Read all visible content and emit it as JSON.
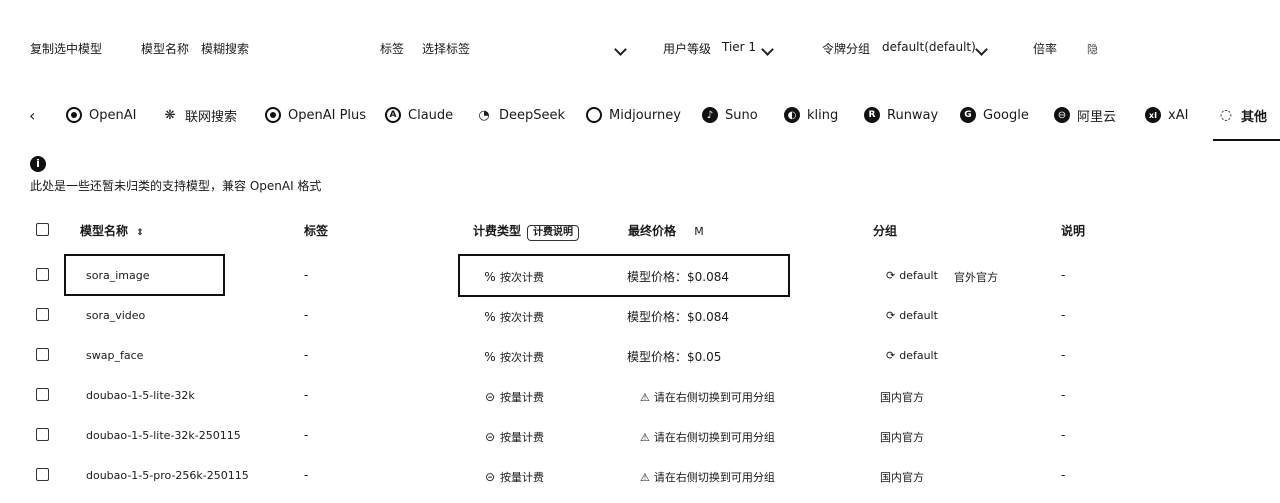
{
  "filters": {
    "copy_selected": "复制选中模型",
    "model_name_label": "模型名称",
    "model_name_placeholder": "模糊搜索",
    "tag_label": "标签",
    "tag_placeholder": "选择标签",
    "user_level_label": "用户等级",
    "user_level_value": "Tier 1",
    "token_group_label": "令牌分组",
    "token_group_value": "default(default)",
    "ratio_label": "倍率",
    "ratio_value": "隐"
  },
  "tabs": [
    {
      "label": "OpenAI",
      "icon": "openai-icon"
    },
    {
      "label": "联网搜索",
      "icon": "web-search-icon"
    },
    {
      "label": "OpenAI Plus",
      "icon": "openai-plus-icon"
    },
    {
      "label": "Claude",
      "icon": "claude-icon"
    },
    {
      "label": "DeepSeek",
      "icon": "deepseek-icon"
    },
    {
      "label": "Midjourney",
      "icon": "midjourney-icon"
    },
    {
      "label": "Suno",
      "icon": "suno-icon"
    },
    {
      "label": "kling",
      "icon": "kling-icon"
    },
    {
      "label": "Runway",
      "icon": "runway-icon"
    },
    {
      "label": "Google",
      "icon": "google-icon"
    },
    {
      "label": "阿里云",
      "icon": "aliyun-icon"
    },
    {
      "label": "xAI",
      "icon": "xai-icon"
    },
    {
      "label": "其他",
      "icon": "other-icon"
    }
  ],
  "info_text": "此处是一些还暂未归类的支持模型，兼容 OpenAI 格式",
  "table": {
    "headers": {
      "name": "模型名称",
      "tags": "标签",
      "billing": "计费类型",
      "billing_badge": "计费说明",
      "price": "最终价格",
      "price_unit": "M",
      "group": "分组",
      "desc": "说明"
    },
    "rows": [
      {
        "name": "sora_image",
        "tags": "-",
        "billing": "按次计费",
        "price": "模型价格：$0.084",
        "group": "default",
        "group_extra": "官外官方",
        "desc": "-"
      },
      {
        "name": "sora_video",
        "tags": "-",
        "billing": "按次计费",
        "price": "模型价格：$0.084",
        "group": "default",
        "group_extra": "",
        "desc": "-"
      },
      {
        "name": "swap_face",
        "tags": "-",
        "billing": "按次计费",
        "price": "模型价格：$0.05",
        "group": "default",
        "group_extra": "",
        "desc": "-"
      },
      {
        "name": "doubao-1-5-lite-32k",
        "tags": "-",
        "billing": "按量计费",
        "price": "请在右侧切换到可用分组",
        "group": "国内官方",
        "group_extra": "",
        "desc": "-"
      },
      {
        "name": "doubao-1-5-lite-32k-250115",
        "tags": "-",
        "billing": "按量计费",
        "price": "请在右侧切换到可用分组",
        "group": "国内官方",
        "group_extra": "",
        "desc": "-"
      },
      {
        "name": "doubao-1-5-pro-256k-250115",
        "tags": "-",
        "billing": "按量计费",
        "price": "请在右侧切换到可用分组",
        "group": "国内官方",
        "group_extra": "",
        "desc": "-"
      }
    ]
  }
}
